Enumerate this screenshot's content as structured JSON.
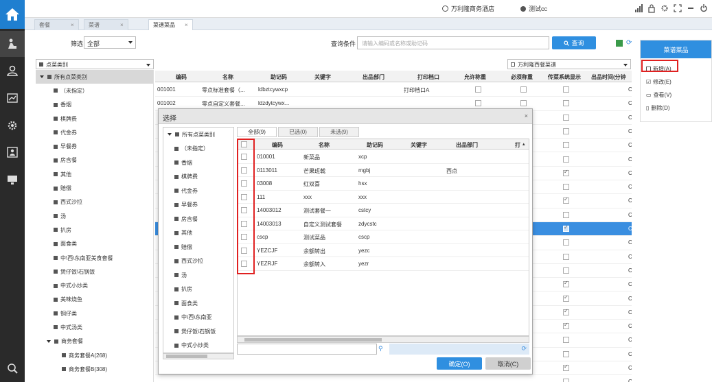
{
  "topbar": {
    "hotel": "万利隆商务酒店",
    "user": "测试cc"
  },
  "tabs": [
    {
      "label": "套餐",
      "close": "×"
    },
    {
      "label": "菜谱",
      "close": "×"
    },
    {
      "label": "菜谱菜品",
      "close": "×"
    }
  ],
  "filter": {
    "label": "筛选",
    "value": "全部"
  },
  "query": {
    "label": "查询条件",
    "placeholder": "请输入编码或名称或助记码",
    "button": "查询"
  },
  "category_select": "点菜类别",
  "menu_select": "万利隆西餐菜谱",
  "tree": [
    {
      "label": "所有点菜类别",
      "level": 0,
      "expanded": true
    },
    {
      "label": "（未指定）",
      "level": 1
    },
    {
      "label": "香烟",
      "level": 1
    },
    {
      "label": "棋牌费",
      "level": 1
    },
    {
      "label": "代金券",
      "level": 1
    },
    {
      "label": "早餐券",
      "level": 1
    },
    {
      "label": "房含餐",
      "level": 1
    },
    {
      "label": "其他",
      "level": 1
    },
    {
      "label": "赔偿",
      "level": 1
    },
    {
      "label": "西式沙拉",
      "level": 1
    },
    {
      "label": "汤",
      "level": 1
    },
    {
      "label": "扒房",
      "level": 1
    },
    {
      "label": "面食类",
      "level": 1
    },
    {
      "label": "中\\西\\东南亚美食套餐",
      "level": 1
    },
    {
      "label": "煲仔饭\\石锅饭",
      "level": 1
    },
    {
      "label": "中式小炒类",
      "level": 1
    },
    {
      "label": "美味烧鱼",
      "level": 1
    },
    {
      "label": "铜仔类",
      "level": 1
    },
    {
      "label": "中式汤类",
      "level": 1
    },
    {
      "label": "商务套餐",
      "level": 1,
      "expanded": true
    },
    {
      "label": "商务套餐A(268)",
      "level": 2
    },
    {
      "label": "商务套餐B(308)",
      "level": 2
    }
  ],
  "grid": {
    "headers": [
      "编码",
      "名称",
      "助记码",
      "关键字",
      "出品部门",
      "打印档口",
      "允许称重",
      "必须称重",
      "传菜系统显示",
      "出品时间(分钟"
    ],
    "rows": [
      {
        "code": "001001",
        "name": "零点标准套餐（...",
        "mnemonic": "ldbztcywxcp",
        "print": "打印档口A",
        "display": false
      },
      {
        "code": "001002",
        "name": "零点自定义套餐...",
        "mnemonic": "ldzdytcywx...",
        "print": "",
        "display": false
      },
      {
        "display": false
      },
      {
        "display": false
      },
      {
        "display": false
      },
      {
        "display": false
      },
      {
        "display": true
      },
      {
        "display": false
      },
      {
        "display": true
      },
      {
        "display": false
      },
      {
        "display": true,
        "selected": true
      },
      {
        "display": false
      },
      {
        "display": false
      },
      {
        "display": false
      },
      {
        "display": true
      },
      {
        "display": true
      },
      {
        "display": true
      },
      {
        "display": true
      },
      {
        "display": false
      },
      {
        "display": false
      },
      {
        "display": true
      },
      {
        "display": false
      }
    ],
    "edge": "C"
  },
  "right_panel": {
    "title": "菜谱菜品",
    "actions": [
      "新增(A)",
      "修改(E)",
      "查看(V)",
      "删除(D)"
    ]
  },
  "dialog": {
    "title": "选择",
    "close": "×",
    "tabs": [
      "全部(9)",
      "已选(0)",
      "未选(9)"
    ],
    "tree": [
      "所有点菜类别",
      "（未指定）",
      "香烟",
      "棋牌费",
      "代金券",
      "早餐券",
      "房含餐",
      "其他",
      "赔偿",
      "西式沙拉",
      "汤",
      "扒房",
      "面食类",
      "中\\西\\东南亚",
      "煲仔饭\\石锅饭",
      "中式小炒类"
    ],
    "headers": [
      "编码",
      "名称",
      "助记码",
      "关键字",
      "出品部门",
      "打"
    ],
    "rows": [
      {
        "code": "010001",
        "name": "新菜品",
        "mnemonic": "xcp",
        "dept": ""
      },
      {
        "code": "0113011",
        "name": "芒果班戟",
        "mnemonic": "mgbj",
        "dept": "西点"
      },
      {
        "code": "03008",
        "name": "红双喜",
        "mnemonic": "hsx",
        "dept": ""
      },
      {
        "code": "111",
        "name": "xxx",
        "mnemonic": "xxx",
        "dept": ""
      },
      {
        "code": "14003012",
        "name": "测试套餐一",
        "mnemonic": "cstcy",
        "dept": ""
      },
      {
        "code": "14003013",
        "name": "自定义测试套餐",
        "mnemonic": "zdycstc",
        "dept": ""
      },
      {
        "code": "cscp",
        "name": "测试菜品",
        "mnemonic": "cscp",
        "dept": ""
      },
      {
        "code": "YEZCJF",
        "name": "余额转出",
        "mnemonic": "yezc",
        "dept": ""
      },
      {
        "code": "YEZRJF",
        "name": "余额转入",
        "mnemonic": "yezr",
        "dept": ""
      }
    ],
    "ok": "确定(O)",
    "cancel": "取消(C)"
  },
  "colors": {
    "accent": "#2f8fe0",
    "highlight": "#e02020",
    "nav": "#2a2a2a"
  }
}
